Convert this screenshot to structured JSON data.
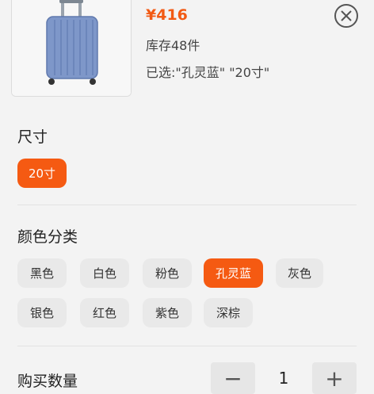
{
  "product": {
    "price": "¥416",
    "stock": "库存48件",
    "selected": "已选:\"孔灵蓝\" \"20寸\""
  },
  "size": {
    "title": "尺寸",
    "options": [
      "20寸"
    ],
    "selected_index": 0
  },
  "color": {
    "title": "颜色分类",
    "options": [
      "黑色",
      "白色",
      "粉色",
      "孔灵蓝",
      "灰色",
      "银色",
      "红色",
      "紫色",
      "深棕"
    ],
    "selected_index": 3
  },
  "quantity": {
    "title": "购买数量",
    "value": "1",
    "minus": "−",
    "plus": "+"
  },
  "colors": {
    "accent": "#f55a12",
    "chip_bg": "#e9e9e9"
  },
  "icons": {
    "close": "close-icon"
  }
}
